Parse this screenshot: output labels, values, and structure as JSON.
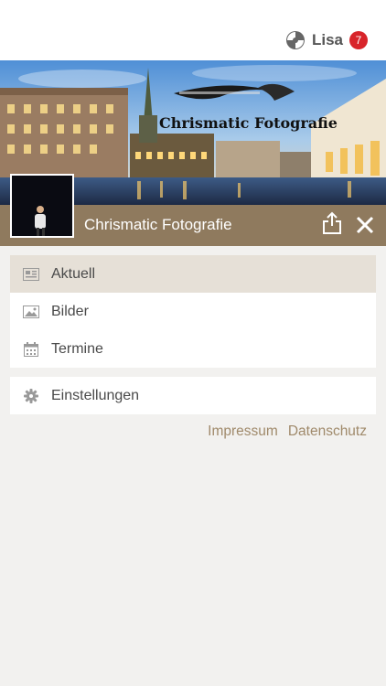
{
  "topbar": {
    "user_name": "Lisa",
    "notification_count": "7"
  },
  "header": {
    "banner_logo_text": "Chrismatic Fotografie",
    "page_name": "Chrismatic Fotografie"
  },
  "menu": {
    "items": [
      {
        "label": "Aktuell",
        "icon": "newspaper-icon",
        "active": true
      },
      {
        "label": "Bilder",
        "icon": "image-icon",
        "active": false
      },
      {
        "label": "Termine",
        "icon": "calendar-icon",
        "active": false
      }
    ],
    "settings": {
      "label": "Einstellungen",
      "icon": "gear-icon"
    }
  },
  "footer": {
    "impressum": "Impressum",
    "datenschutz": "Datenschutz"
  },
  "colors": {
    "caption_bar": "#8f7a5e",
    "accent_link": "#a08a6b",
    "badge": "#d8242a",
    "active_item": "#e6e0d7"
  }
}
